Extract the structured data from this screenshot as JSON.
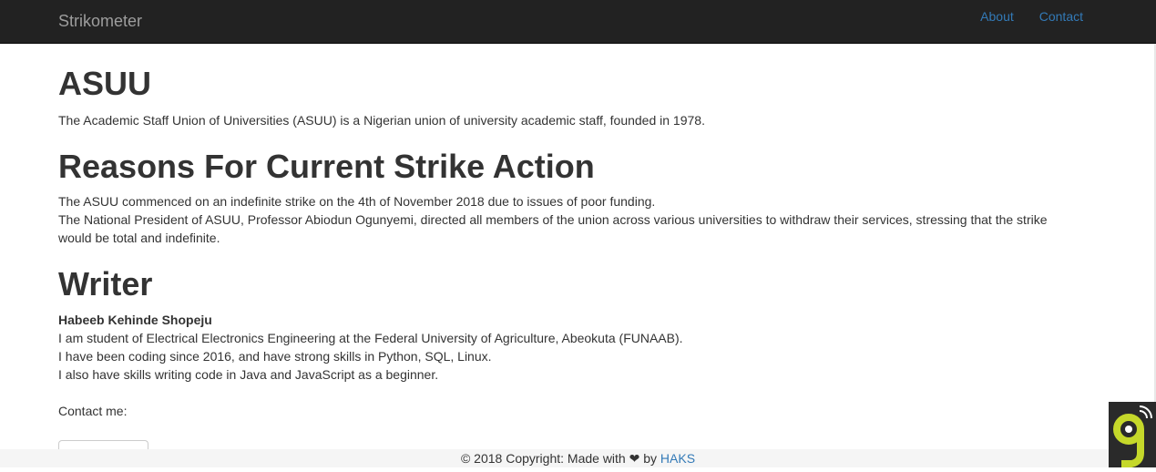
{
  "navbar": {
    "brand": "Strikometer",
    "links": [
      {
        "label": "About"
      },
      {
        "label": "Contact"
      }
    ]
  },
  "sections": {
    "asuu": {
      "heading": "ASUU",
      "text": "The Academic Staff Union of Universities (ASUU) is a Nigerian union of university academic staff, founded in 1978."
    },
    "reasons": {
      "heading": "Reasons For Current Strike Action",
      "line1": "The ASUU commenced on an indefinite strike on the 4th of November 2018 due to issues of poor funding.",
      "line2": "The National President of ASUU, Professor Abiodun Ogunyemi, directed all members of the union across various universities to withdraw their services, stressing that the strike would be total and indefinite."
    },
    "writer": {
      "heading": "Writer",
      "name": "Habeeb Kehinde Shopeju",
      "line1": "I am student of Electrical Electronics Engineering at the Federal University of Agriculture, Abeokuta (FUNAAB).",
      "line2": "I have been coding since 2016, and have strong skills in Python, SQL, Linux.",
      "line3": "I also have skills writing code in Java and JavaScript as a beginner.",
      "contact_label": "Contact me:"
    }
  },
  "footer": {
    "prefix": "© 2018 Copyright: Made with ❤ by ",
    "link": "HAKS"
  },
  "widget": {
    "icon": "nine-logo-icon",
    "accent": "#c5d82a"
  },
  "colors": {
    "navbar_bg": "#222222",
    "brand": "#9d9d9d",
    "link": "#337ab7",
    "text": "#333333",
    "footer_bg": "#f5f5f5"
  }
}
